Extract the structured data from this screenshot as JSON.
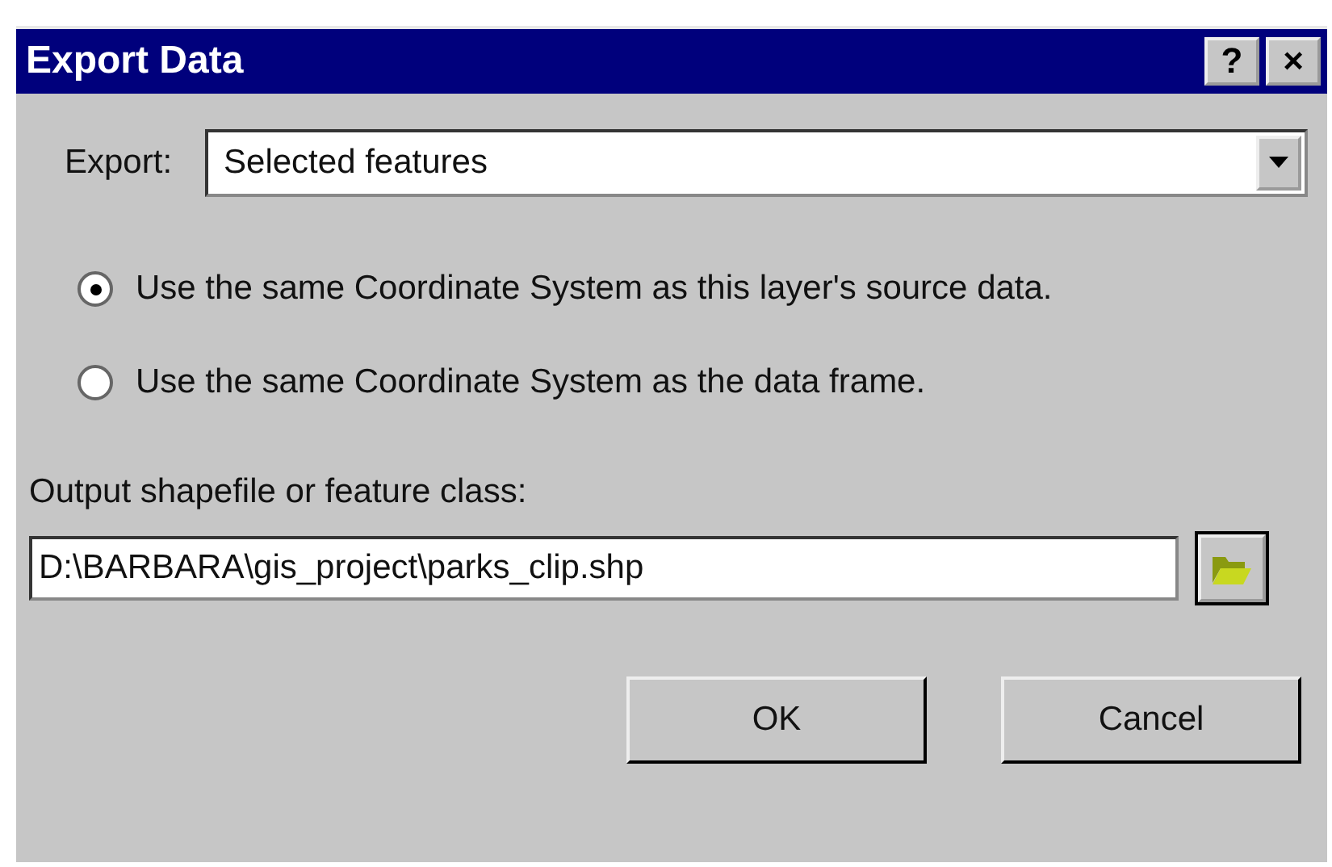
{
  "window": {
    "title": "Export Data",
    "help_button": "?",
    "close_button": "×"
  },
  "export": {
    "label": "Export:",
    "value": "Selected features"
  },
  "coordinate_options": [
    {
      "label": "Use the same Coordinate System as this layer's source data.",
      "selected": true
    },
    {
      "label": "Use the same Coordinate System as the data frame.",
      "selected": false
    }
  ],
  "output": {
    "label": "Output shapefile or feature class:",
    "value": "D:\\BARBARA\\gis_project\\parks_clip.shp"
  },
  "buttons": [
    "OK",
    "Cancel"
  ]
}
